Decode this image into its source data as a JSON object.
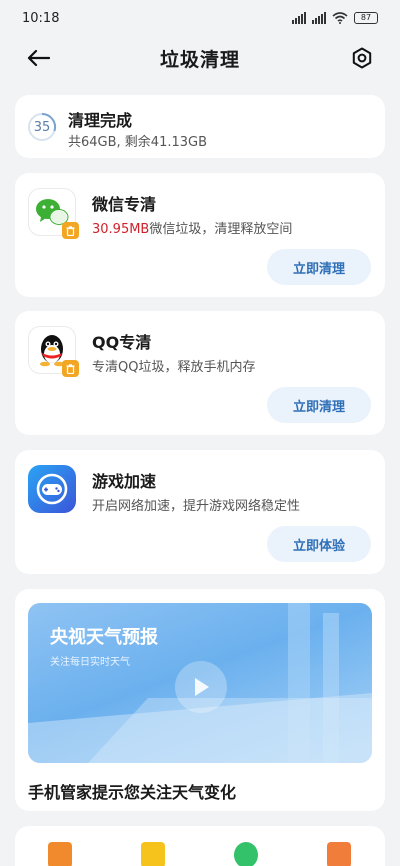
{
  "status_bar": {
    "time": "10:18",
    "battery": "87"
  },
  "header": {
    "title": "垃圾清理"
  },
  "summary": {
    "ring_value": "35",
    "title": "清理完成",
    "subtitle": "共64GB, 剩余41.13GB"
  },
  "features": [
    {
      "title": "微信专清",
      "desc_highlight": "30.95MB",
      "desc": "微信垃圾，清理释放空间",
      "action": "立即清理"
    },
    {
      "title": "QQ专清",
      "desc": "专清QQ垃圾，释放手机内存",
      "action": "立即清理"
    },
    {
      "title": "游戏加速",
      "desc": "开启网络加速，提升游戏网络稳定性",
      "action": "立即体验"
    }
  ],
  "weather": {
    "banner_title": "央视天气预报",
    "banner_sub": "关注每日实时天气",
    "caption": "手机管家提示您关注天气变化"
  },
  "colors": {
    "accent": "#2f6fb8",
    "highlight": "#d0212a",
    "wechat": "#3cb034",
    "game": "#2f6fd8"
  }
}
